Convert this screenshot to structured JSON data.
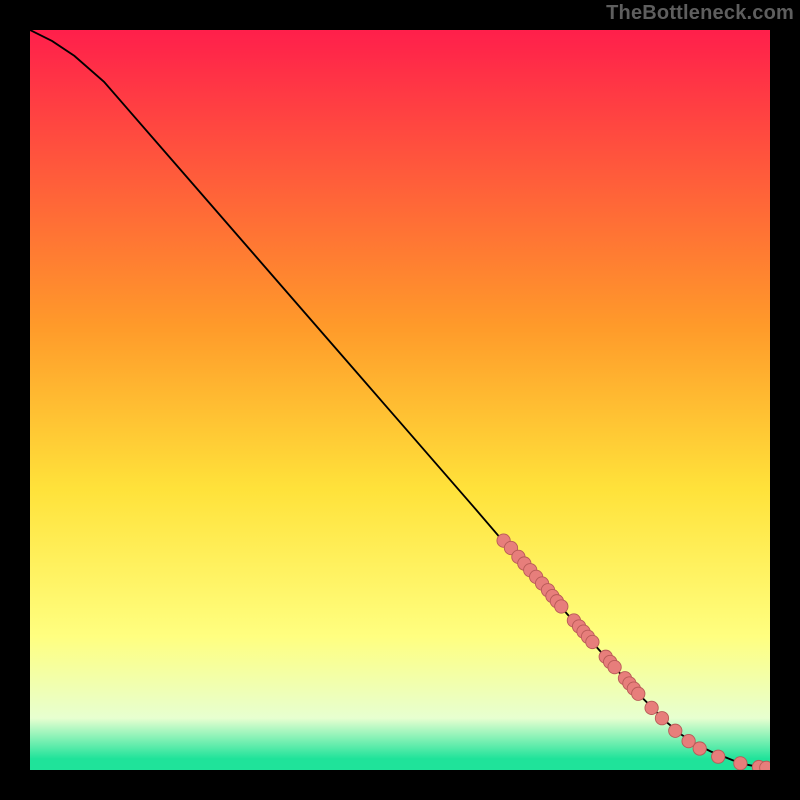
{
  "watermark": "TheBottleneck.com",
  "colors": {
    "bg_black": "#000000",
    "curve": "#000000",
    "marker_fill": "#e77e7b",
    "marker_stroke": "#b85a57",
    "grad_top": "#ff1f4b",
    "grad_mid_upper": "#ff9a2a",
    "grad_mid": "#ffe23a",
    "grad_lower": "#ffff80",
    "grad_near_bottom_pale": "#e7ffd0",
    "grad_bottom_green": "#1fe39a"
  },
  "chart_data": {
    "type": "line",
    "title": "",
    "xlabel": "",
    "ylabel": "",
    "xlim": [
      0,
      100
    ],
    "ylim": [
      0,
      100
    ],
    "curve": {
      "x": [
        0,
        3,
        6,
        10,
        20,
        30,
        40,
        50,
        60,
        66,
        70,
        74,
        78,
        82,
        86,
        88,
        90,
        92,
        94,
        95,
        96,
        97,
        98,
        99,
        100
      ],
      "y": [
        100,
        98.5,
        96.5,
        93,
        81.5,
        70,
        58.5,
        47,
        35.5,
        28.5,
        24,
        19.5,
        15,
        10.5,
        6.5,
        4.8,
        3.5,
        2.5,
        1.7,
        1.3,
        1.0,
        0.7,
        0.5,
        0.3,
        0.2
      ]
    },
    "markers": [
      {
        "x": 64.0,
        "y": 31.0,
        "r": 0.9
      },
      {
        "x": 65.0,
        "y": 30.0,
        "r": 0.9
      },
      {
        "x": 66.0,
        "y": 28.8,
        "r": 0.9
      },
      {
        "x": 66.8,
        "y": 27.9,
        "r": 0.9
      },
      {
        "x": 67.6,
        "y": 27.0,
        "r": 0.9
      },
      {
        "x": 68.4,
        "y": 26.1,
        "r": 0.9
      },
      {
        "x": 69.2,
        "y": 25.2,
        "r": 0.9
      },
      {
        "x": 70.0,
        "y": 24.3,
        "r": 0.9
      },
      {
        "x": 70.6,
        "y": 23.5,
        "r": 0.9
      },
      {
        "x": 71.2,
        "y": 22.8,
        "r": 0.9
      },
      {
        "x": 71.8,
        "y": 22.1,
        "r": 0.9
      },
      {
        "x": 73.5,
        "y": 20.2,
        "r": 0.9
      },
      {
        "x": 74.2,
        "y": 19.4,
        "r": 0.9
      },
      {
        "x": 74.8,
        "y": 18.7,
        "r": 0.9
      },
      {
        "x": 75.4,
        "y": 18.0,
        "r": 0.9
      },
      {
        "x": 76.0,
        "y": 17.3,
        "r": 0.9
      },
      {
        "x": 77.8,
        "y": 15.3,
        "r": 0.9
      },
      {
        "x": 78.4,
        "y": 14.6,
        "r": 0.9
      },
      {
        "x": 79.0,
        "y": 13.9,
        "r": 0.9
      },
      {
        "x": 80.4,
        "y": 12.4,
        "r": 0.9
      },
      {
        "x": 81.0,
        "y": 11.7,
        "r": 0.9
      },
      {
        "x": 81.6,
        "y": 11.0,
        "r": 0.9
      },
      {
        "x": 82.2,
        "y": 10.3,
        "r": 0.9
      },
      {
        "x": 84.0,
        "y": 8.4,
        "r": 0.9
      },
      {
        "x": 85.4,
        "y": 7.0,
        "r": 0.9
      },
      {
        "x": 87.2,
        "y": 5.3,
        "r": 0.9
      },
      {
        "x": 89.0,
        "y": 3.9,
        "r": 0.9
      },
      {
        "x": 90.5,
        "y": 2.9,
        "r": 0.9
      },
      {
        "x": 93.0,
        "y": 1.8,
        "r": 0.9
      },
      {
        "x": 96.0,
        "y": 0.9,
        "r": 0.9
      },
      {
        "x": 98.5,
        "y": 0.4,
        "r": 0.9
      },
      {
        "x": 99.5,
        "y": 0.3,
        "r": 0.9
      }
    ],
    "gradient_stops": [
      {
        "offset": 0.0,
        "color_key": "grad_top"
      },
      {
        "offset": 0.4,
        "color_key": "grad_mid_upper"
      },
      {
        "offset": 0.62,
        "color_key": "grad_mid"
      },
      {
        "offset": 0.82,
        "color_key": "grad_lower"
      },
      {
        "offset": 0.93,
        "color_key": "grad_near_bottom_pale"
      },
      {
        "offset": 0.985,
        "color_key": "grad_bottom_green"
      },
      {
        "offset": 1.0,
        "color_key": "grad_bottom_green"
      }
    ]
  }
}
